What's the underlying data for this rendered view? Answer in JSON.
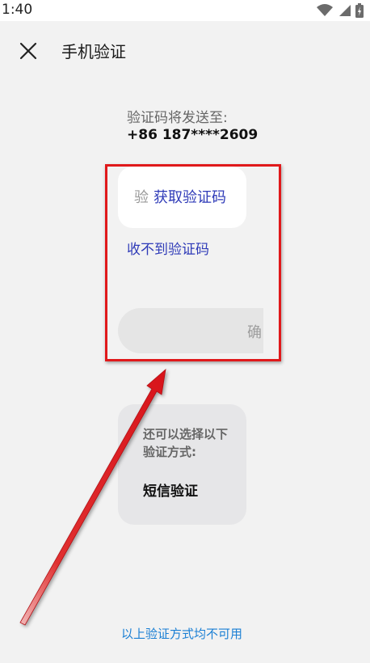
{
  "status_bar": {
    "time": "1:40"
  },
  "header": {
    "title": "手机验证",
    "close_icon": "close-icon"
  },
  "verification": {
    "send_label": "验证码将发送至:",
    "phone_number": "+86 187****2609",
    "code_placeholder": "验",
    "get_code_label": "获取验证码",
    "no_code_label": "收不到验证码",
    "confirm_label": "确"
  },
  "alternatives": {
    "label": "还可以选择以下验证方式:",
    "option_label": "短信验证"
  },
  "footer": {
    "unavailable_label": "以上验证方式均不可用"
  },
  "annotation": {
    "highlight_color": "#e0191b"
  }
}
